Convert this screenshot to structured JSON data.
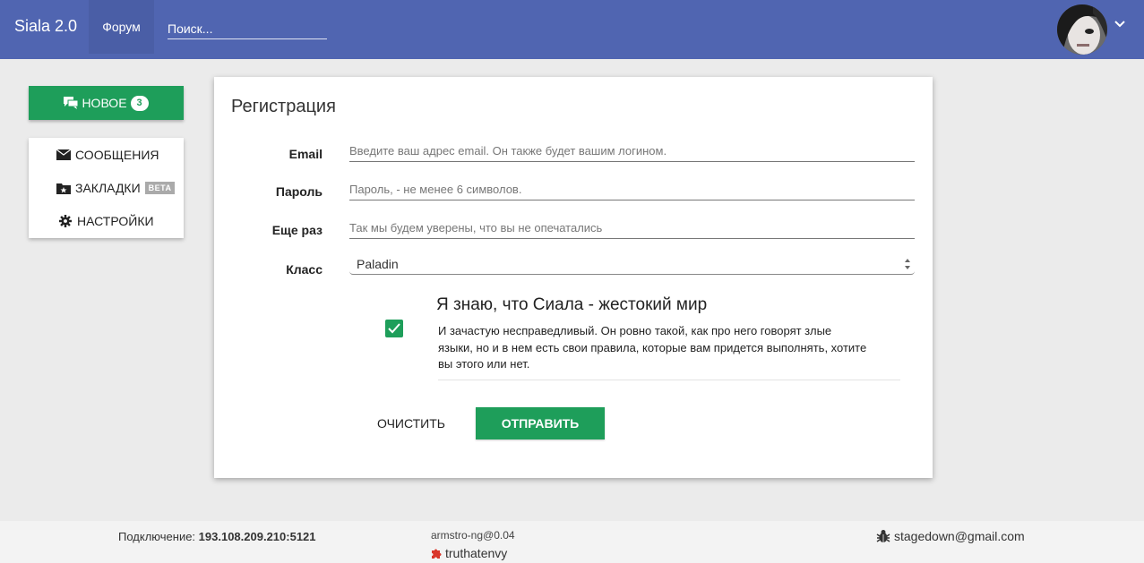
{
  "header": {
    "brand": "Siala 2.0",
    "nav_forum": "Форум",
    "search_placeholder": "Поиск..."
  },
  "sidebar": {
    "new_label": "НОВОЕ",
    "new_count": "3",
    "items": [
      {
        "label": "СООБЩЕНИЯ",
        "icon": "envelope-icon"
      },
      {
        "label": "ЗАКЛАДКИ",
        "icon": "bookmark-folder-icon",
        "badge": "BETA"
      },
      {
        "label": "НАСТРОЙКИ",
        "icon": "gear-icon"
      }
    ]
  },
  "form": {
    "title": "Регистрация",
    "fields": [
      {
        "label": "Email",
        "placeholder": "Введите ваш адрес email. Он также будет вашим логином."
      },
      {
        "label": "Пароль",
        "placeholder": "Пароль, - не менее 6 символов."
      },
      {
        "label": "Еще раз",
        "placeholder": "Так мы будем уверены, что вы не опечатались"
      }
    ],
    "class_label": "Класс",
    "class_value": "Paladin",
    "agree_checked": true,
    "agree_title": "Я знаю, что Сиала - жестокий мир",
    "agree_text": "И зачастую несправедливый. Он ровно такой, как про него говорят злые языки, но и в нем есть свои правила, которые вам придется выполнять, хотите вы этого или нет.",
    "clear_label": "ОЧИСТИТЬ",
    "submit_label": "ОТПРАВИТЬ"
  },
  "footer": {
    "connection_label": "Подключение:",
    "connection_value": "193.108.209.210:5121",
    "version": "armstro-ng@0.04",
    "user": "truthatenvy",
    "email": "stagedown@gmail.com"
  },
  "colors": {
    "header": "#5065b1",
    "accent": "#1e9e5a",
    "background": "#ebebeb"
  }
}
